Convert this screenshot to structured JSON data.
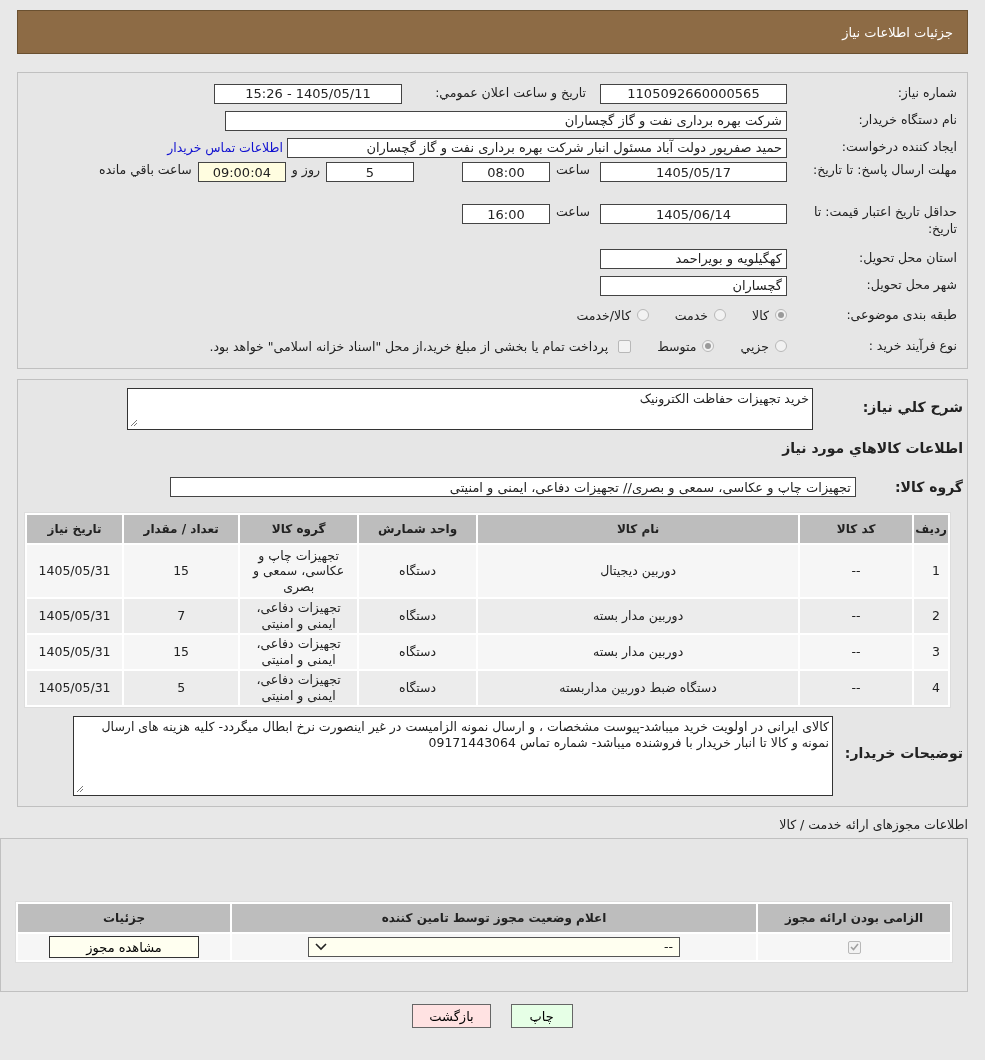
{
  "header": {
    "title": "جزئیات اطلاعات نیاز"
  },
  "need_number": {
    "label": "شماره نیاز:",
    "value": "1105092660000565"
  },
  "announce": {
    "label": "تاریخ و ساعت اعلان عمومي:",
    "value": "1405/05/11 - 15:26"
  },
  "buyer": {
    "label": "نام دستگاه خریدار:",
    "value": "شرکت بهره برداری نفت و گاز گچساران"
  },
  "requester": {
    "label": "ایجاد کننده درخواست:",
    "value": "حمید  صفرپور دولت آباد مسئول انبار شرکت بهره برداری نفت و گاز گچساران",
    "link": "اطلاعات تماس خریدار"
  },
  "deadline": {
    "label": "مهلت ارسال پاسخ: تا تاریخ:",
    "date": "1405/05/17",
    "time_label": "ساعت",
    "time": "08:00",
    "days": "5",
    "days_label": "روز و",
    "remaining": "09:00:04",
    "remaining_label": "ساعت باقي مانده"
  },
  "validity": {
    "label": "حداقل تاریخ اعتبار قیمت: تا تاریخ:",
    "date": "1405/06/14",
    "time_label": "ساعت",
    "time": "16:00"
  },
  "province": {
    "label": "استان محل تحویل:",
    "value": "کهگیلویه و بویراحمد"
  },
  "city": {
    "label": "شهر محل تحویل:",
    "value": "گچساران"
  },
  "category": {
    "label": "طبقه بندی موضوعی:",
    "options": [
      {
        "label": "کالا",
        "selected": true
      },
      {
        "label": "خدمت",
        "selected": false
      },
      {
        "label": "کالا/خدمت",
        "selected": false
      }
    ]
  },
  "process": {
    "label": "نوع فرآیند خرید :",
    "options": [
      {
        "label": "جزیي",
        "selected": false
      },
      {
        "label": "متوسط",
        "selected": true
      }
    ],
    "payment": {
      "checked": false,
      "label": "پرداخت تمام یا بخشی از مبلغ خرید،از محل \"اسناد خزانه اسلامی\" خواهد بود."
    }
  },
  "description": {
    "label": "شرح کلي نیاز:",
    "value": "خرید تجهیزات حفاظت الکترونیک"
  },
  "goods_title": "اطلاعات کالاهاي مورد نياز",
  "goods_group": {
    "label": "گروه کالا:",
    "value": "تجهیزات چاپ و عکاسی، سمعی و بصری// تجهیزات دفاعی، ایمنی و امنیتی"
  },
  "goods_table": {
    "columns": [
      "ردیف",
      "کد کالا",
      "نام کالا",
      "واحد شمارش",
      "گروه کالا",
      "تعداد / مقدار",
      "تاریخ نیاز"
    ],
    "rows": [
      [
        "1",
        "--",
        "دوربین دیجیتال",
        "دستگاه",
        "تجهیزات چاپ و عکاسی، سمعی و بصری",
        "15",
        "1405/05/31"
      ],
      [
        "2",
        "--",
        "دوربین مدار بسته",
        "دستگاه",
        "تجهیزات دفاعی، ایمنی و امنیتی",
        "7",
        "1405/05/31"
      ],
      [
        "3",
        "--",
        "دوربین مدار بسته",
        "دستگاه",
        "تجهیزات دفاعی، ایمنی و امنیتی",
        "15",
        "1405/05/31"
      ],
      [
        "4",
        "--",
        "دستگاه ضبط دوربین مداربسته",
        "دستگاه",
        "تجهیزات دفاعی، ایمنی و امنیتی",
        "5",
        "1405/05/31"
      ]
    ]
  },
  "buyer_notes": {
    "label": "توضیحات خریدار:",
    "value": "کالای ایرانی در اولویت خرید میباشد-پیوست مشخصات ، و ارسال نمونه الزامیست در غیر اینصورت نرخ ابطال میگردد- کلیه هزینه های ارسال نمونه و  کالا  تا انبار خریدار با فروشنده میباشد- شماره تماس 09171443064"
  },
  "permits_title": "اطلاعات مجوزهای ارائه خدمت / کالا",
  "permits_table": {
    "columns": [
      "الزامی بودن ارائه مجوز",
      "اعلام وضعیت مجوز توسط تامین کننده",
      "جزئیات"
    ],
    "rows": [
      {
        "required": true,
        "status": "--",
        "details": "مشاهده مجوز"
      }
    ]
  },
  "buttons": [
    {
      "label": "چاپ",
      "kind": "print"
    },
    {
      "label": "بازگشت",
      "kind": "back"
    }
  ]
}
